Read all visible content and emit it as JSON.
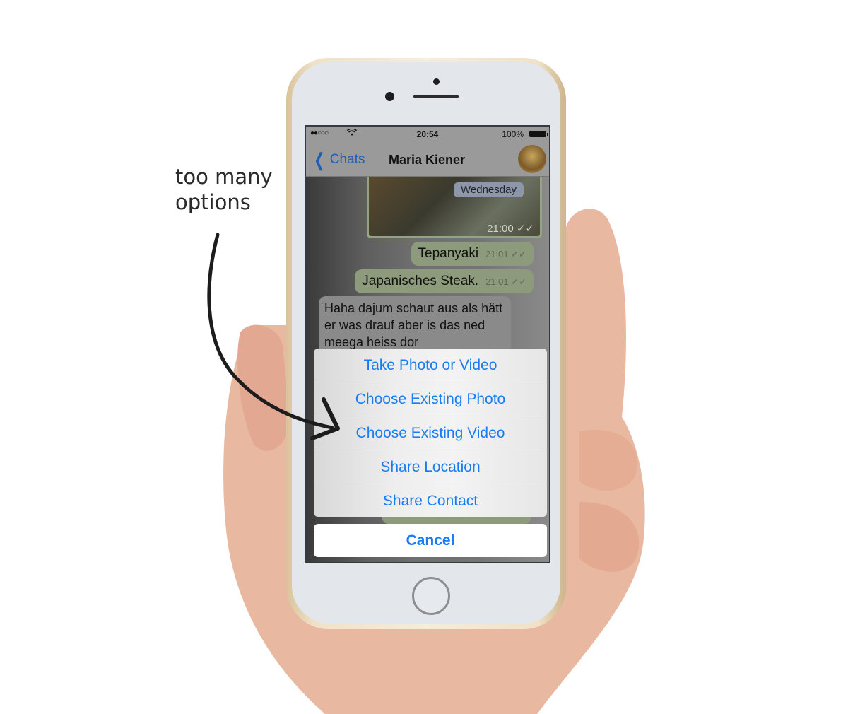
{
  "annotation": {
    "text_line1": "too many",
    "text_line2": "options"
  },
  "status_bar": {
    "signal": "●●○○○",
    "wifi_icon": "wifi-icon",
    "time": "20:54",
    "battery": "100%"
  },
  "nav": {
    "back_label": "Chats",
    "title": "Maria Kiener"
  },
  "chat": {
    "day_badge": "Wednesday",
    "photo_time": "21:00 ✓✓",
    "messages": [
      {
        "text": "Tepanyaki",
        "time": "21:01 ✓✓"
      },
      {
        "text": "Japanisches Steak.",
        "time": "21:01 ✓✓"
      }
    ],
    "incoming": "Haha dajum schaut aus als hätt er was drauf aber is das ned meega heiss dor"
  },
  "action_sheet": {
    "items": [
      "Take Photo or Video",
      "Choose Existing Photo",
      "Choose Existing Video",
      "Share Location",
      "Share Contact"
    ],
    "cancel": "Cancel"
  },
  "colors": {
    "accent": "#1a7cf2",
    "outgoing_bubble": "#8d9b7c"
  }
}
